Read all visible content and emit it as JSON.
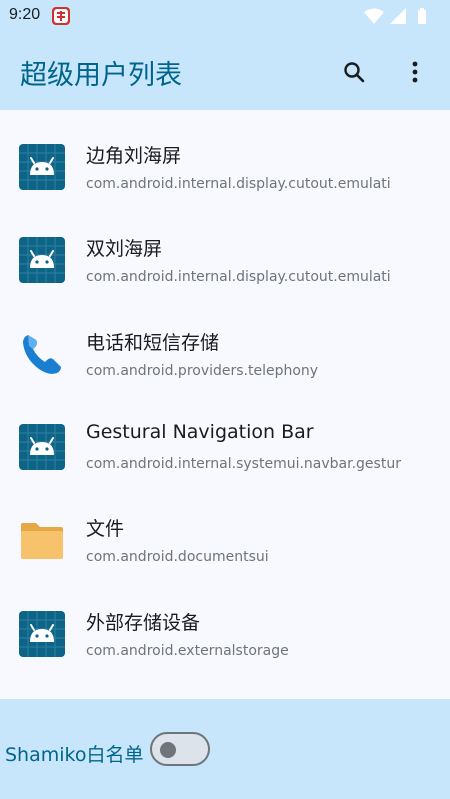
{
  "status_bar": {
    "time": "9:20"
  },
  "app_bar": {
    "title": "超级用户列表"
  },
  "apps": [
    {
      "label": "边角刘海屏",
      "package": "com.android.internal.display.cutout.emulati",
      "icon": "android-icon"
    },
    {
      "label": "双刘海屏",
      "package": "com.android.internal.display.cutout.emulati",
      "icon": "android-icon"
    },
    {
      "label": "电话和短信存储",
      "package": "com.android.providers.telephony",
      "icon": "phone-icon"
    },
    {
      "label": "Gestural Navigation Bar",
      "package": "com.android.internal.systemui.navbar.gestur",
      "icon": "android-icon"
    },
    {
      "label": "文件",
      "package": "com.android.documentsui",
      "icon": "folder-icon"
    },
    {
      "label": "外部存储设备",
      "package": "com.android.externalstorage",
      "icon": "android-icon"
    }
  ],
  "bottom_bar": {
    "whitelist_label": "Shamiko白名单",
    "whitelist_enabled": false
  },
  "colors": {
    "accent": "#00658c",
    "app_bar_bg": "#c7e5fb",
    "android_icon_bg": "#0e6486",
    "folder": "#f6c26b",
    "phone": "#1b7fd1"
  }
}
